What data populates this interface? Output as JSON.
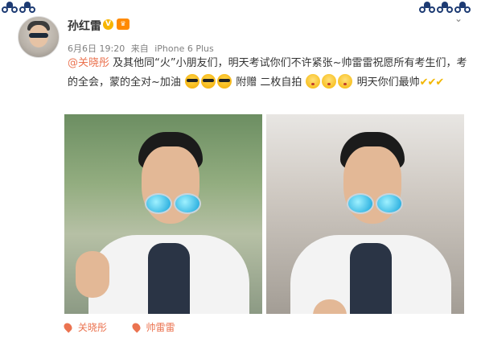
{
  "post": {
    "username": "孙红雷",
    "date": "6月6日 19:20",
    "source_prefix": "来自",
    "source": "iPhone 6 Plus",
    "mention": "@关晓彤",
    "text1": "及其他同“火”小朋友们，明天考试你们不许紧张~帅雷雷祝愿所有考生们，考的全会，蒙的全对~加油",
    "text2": " 附赠 二枚自拍",
    "text3": "明天你们最帅"
  },
  "tags": [
    {
      "label": "关晓彤"
    },
    {
      "label": "帅雷雷"
    }
  ],
  "icons": {
    "verified": "verified-badge-icon",
    "member": "member-crown-icon",
    "more": "chevron-down-icon",
    "tag": "location-tag-icon"
  },
  "colors": {
    "link": "#eb7350",
    "verified": "#f7b500",
    "text": "#333333",
    "meta": "#808080"
  }
}
